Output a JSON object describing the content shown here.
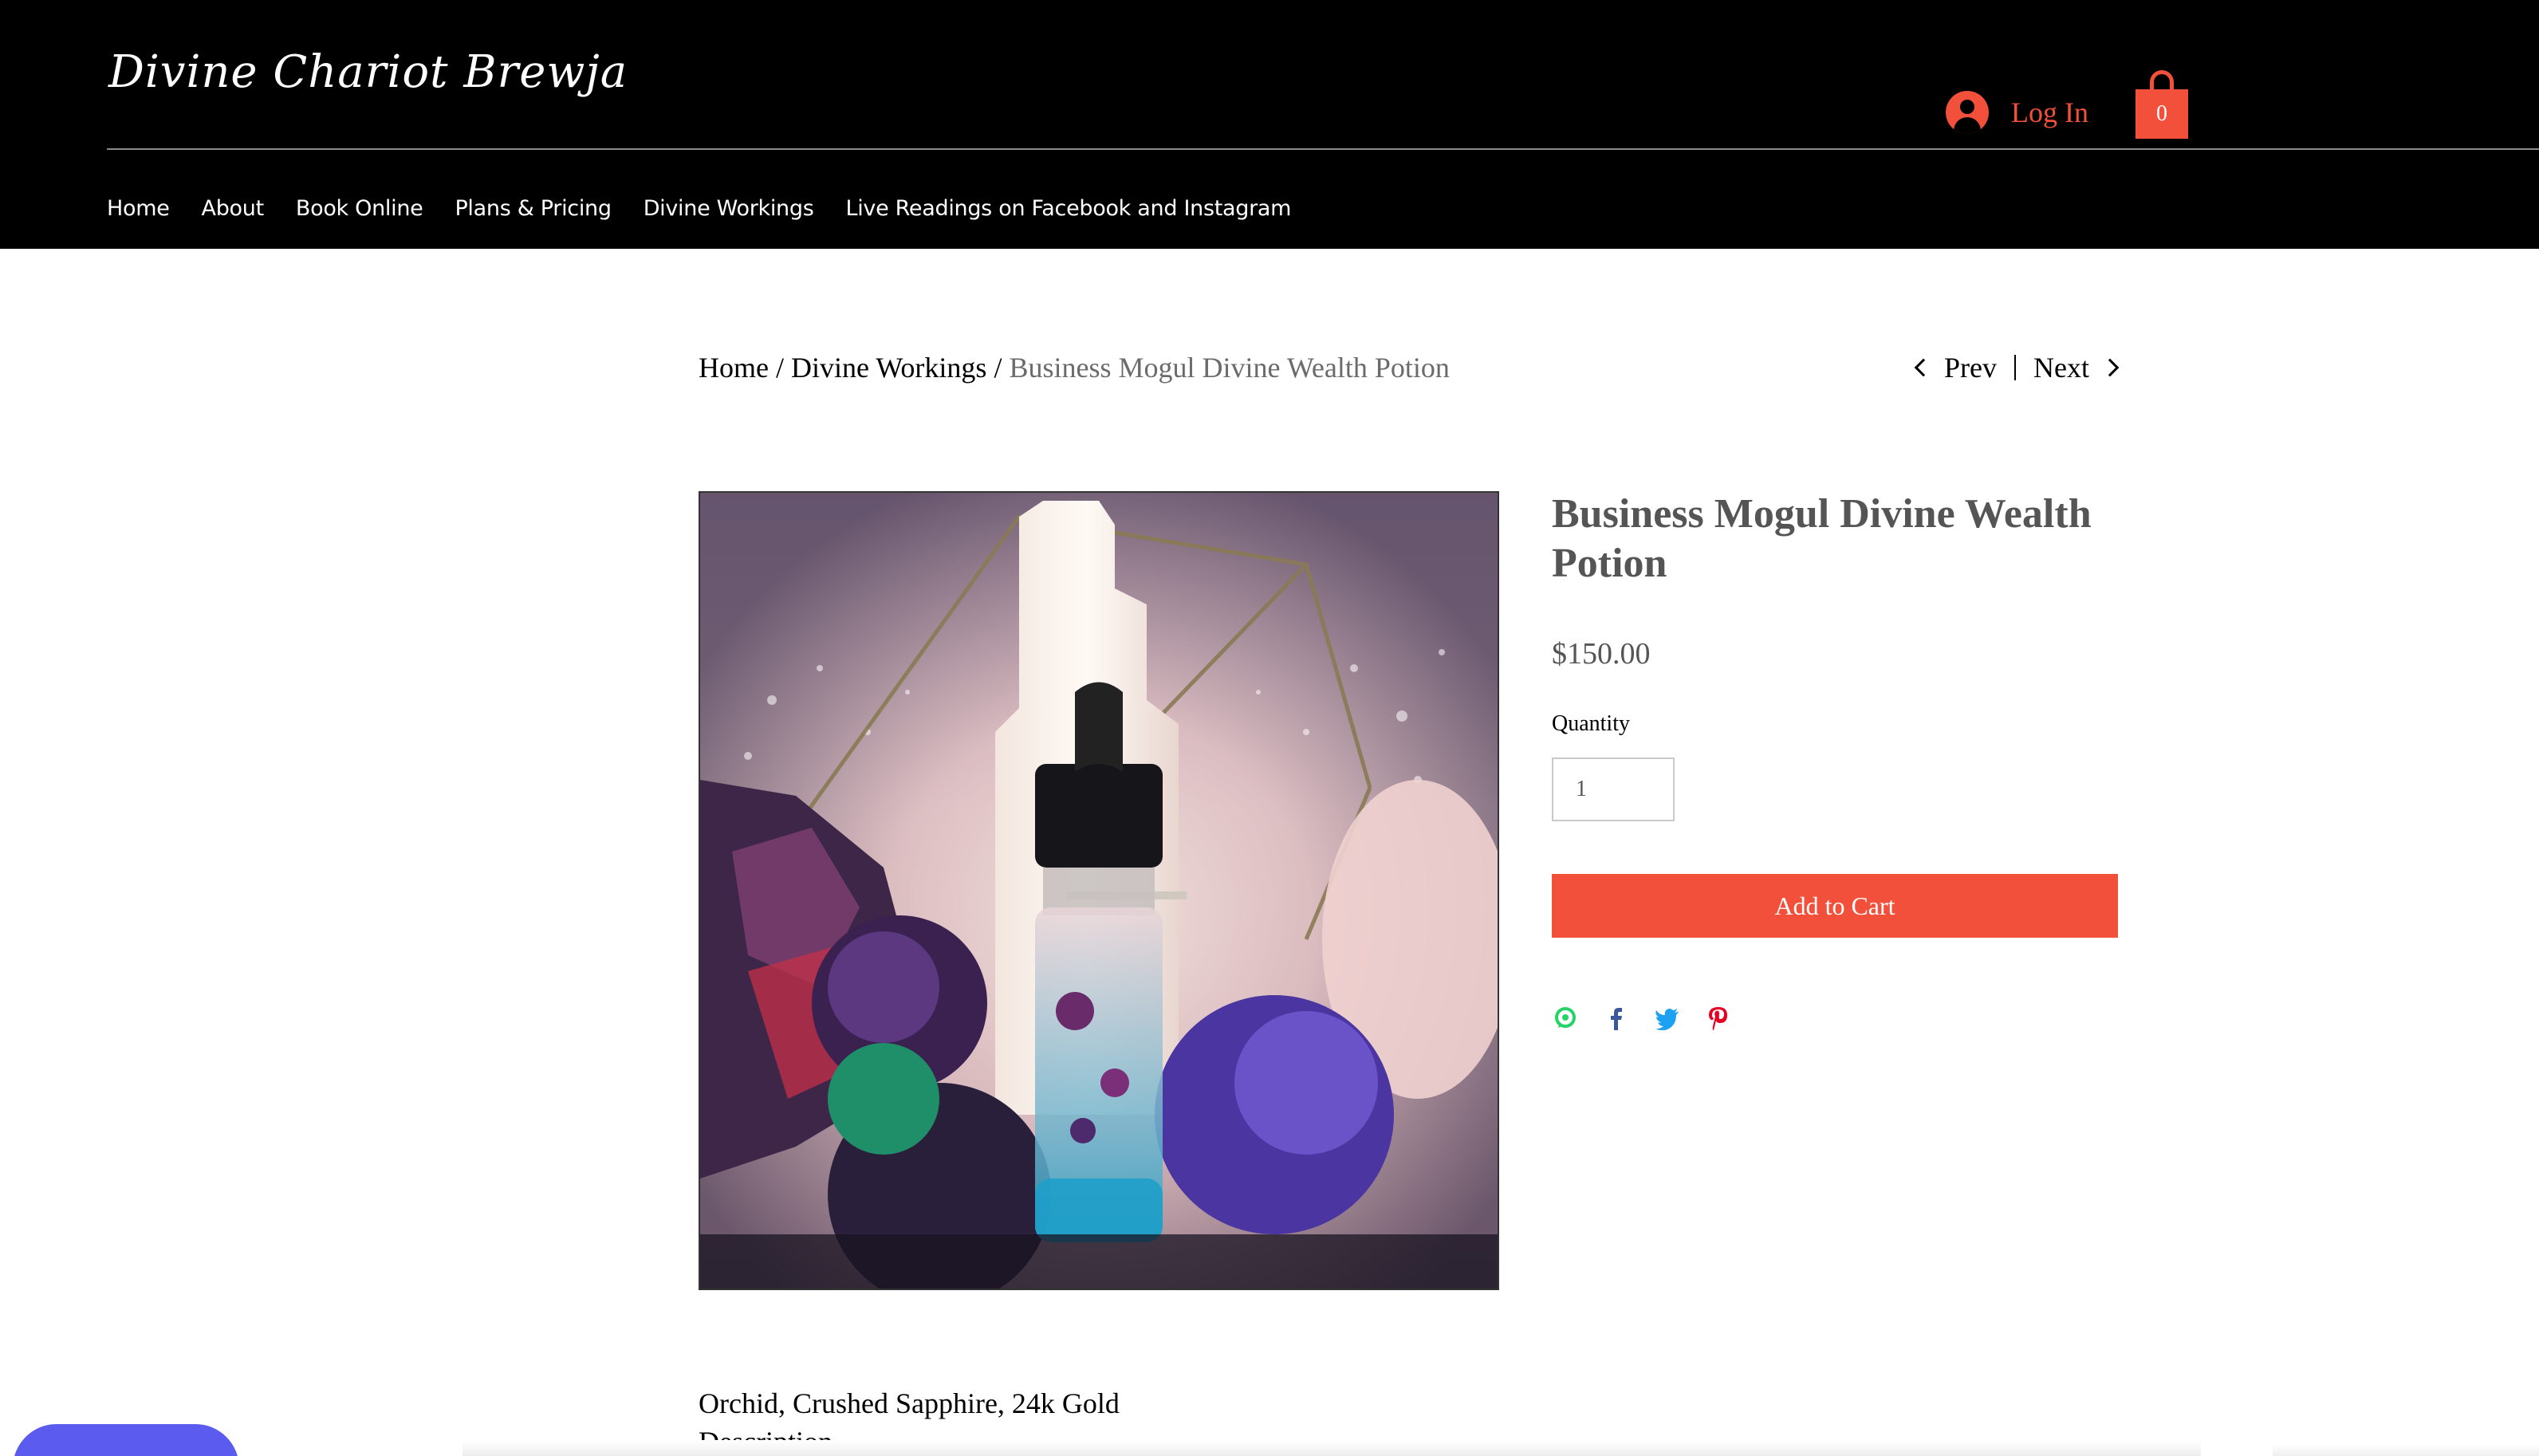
{
  "header": {
    "brand": "Divine Chariot Brewja",
    "login_label": "Log In",
    "cart_count": "0",
    "nav": [
      "Home",
      "About",
      "Book Online",
      "Plans & Pricing",
      "Divine Workings",
      "Live Readings on Facebook and Instagram"
    ]
  },
  "breadcrumb": {
    "items": [
      "Home",
      "Divine Workings"
    ],
    "separator": "/",
    "current": "Business Mogul Divine Wealth Potion"
  },
  "pager": {
    "prev": "Prev",
    "next": "Next"
  },
  "product": {
    "title": "Business Mogul Divine Wealth Potion",
    "price": "$150.00",
    "quantity_label": "Quantity",
    "quantity_value": "1",
    "add_to_cart": "Add to Cart",
    "share": [
      "whatsapp-icon",
      "facebook-icon",
      "twitter-icon",
      "pinterest-icon"
    ],
    "description_lines": [
      "Orchid, Crushed Sapphire, 24k Gold",
      "Description"
    ]
  },
  "colors": {
    "accent": "#f2503b",
    "header_bg": "#000000",
    "muted_text": "#6b6b6b",
    "chat": "#5b5bf0"
  }
}
